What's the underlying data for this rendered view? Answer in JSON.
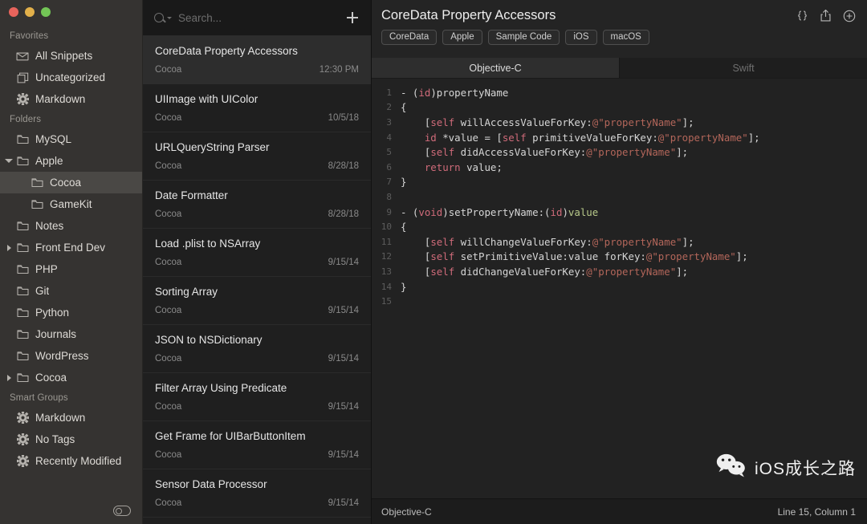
{
  "window": {
    "traffic_lights": [
      "close",
      "minimize",
      "zoom"
    ],
    "colors": {
      "close": "#e8645c",
      "minimize": "#e2b04a",
      "zoom": "#73c556"
    }
  },
  "sidebar": {
    "sections": [
      {
        "title": "Favorites",
        "items": [
          {
            "label": "All Snippets",
            "icon": "inbox-icon",
            "indent": 0,
            "disclosure": "none",
            "selected": false
          },
          {
            "label": "Uncategorized",
            "icon": "stack-icon",
            "indent": 0,
            "disclosure": "none",
            "selected": false
          },
          {
            "label": "Markdown",
            "icon": "gear-icon",
            "indent": 0,
            "disclosure": "none",
            "selected": false
          }
        ]
      },
      {
        "title": "Folders",
        "items": [
          {
            "label": "MySQL",
            "icon": "folder-icon",
            "indent": 0,
            "disclosure": "none",
            "selected": false
          },
          {
            "label": "Apple",
            "icon": "folder-icon",
            "indent": 0,
            "disclosure": "open",
            "selected": false
          },
          {
            "label": "Cocoa",
            "icon": "folder-icon",
            "indent": 1,
            "disclosure": "none",
            "selected": true
          },
          {
            "label": "GameKit",
            "icon": "folder-icon",
            "indent": 1,
            "disclosure": "none",
            "selected": false
          },
          {
            "label": "Notes",
            "icon": "folder-icon",
            "indent": 0,
            "disclosure": "none",
            "selected": false
          },
          {
            "label": "Front End Dev",
            "icon": "folder-icon",
            "indent": 0,
            "disclosure": "closed",
            "selected": false
          },
          {
            "label": "PHP",
            "icon": "folder-icon",
            "indent": 0,
            "disclosure": "none",
            "selected": false
          },
          {
            "label": "Git",
            "icon": "folder-icon",
            "indent": 0,
            "disclosure": "none",
            "selected": false
          },
          {
            "label": "Python",
            "icon": "folder-icon",
            "indent": 0,
            "disclosure": "none",
            "selected": false
          },
          {
            "label": "Journals",
            "icon": "folder-icon",
            "indent": 0,
            "disclosure": "none",
            "selected": false
          },
          {
            "label": "WordPress",
            "icon": "folder-icon",
            "indent": 0,
            "disclosure": "none",
            "selected": false
          },
          {
            "label": "Cocoa",
            "icon": "folder-icon",
            "indent": 0,
            "disclosure": "closed",
            "selected": false
          }
        ]
      },
      {
        "title": "Smart Groups",
        "items": [
          {
            "label": "Markdown",
            "icon": "gear-icon",
            "indent": 0,
            "disclosure": "none",
            "selected": false
          },
          {
            "label": "No Tags",
            "icon": "gear-icon",
            "indent": 0,
            "disclosure": "none",
            "selected": false
          },
          {
            "label": "Recently Modified",
            "icon": "gear-icon",
            "indent": 0,
            "disclosure": "none",
            "selected": false
          }
        ]
      }
    ],
    "bottom_toggle": "sidebar-toggle-icon"
  },
  "search": {
    "placeholder": "Search...",
    "value": "",
    "icon": "search-icon",
    "add_button": "add-snippet-icon"
  },
  "snippets": [
    {
      "title": "CoreData Property Accessors",
      "folder": "Cocoa",
      "date": "12:30 PM",
      "selected": true
    },
    {
      "title": "UIImage with UIColor",
      "folder": "Cocoa",
      "date": "10/5/18",
      "selected": false
    },
    {
      "title": "URLQueryString Parser",
      "folder": "Cocoa",
      "date": "8/28/18",
      "selected": false
    },
    {
      "title": "Date Formatter",
      "folder": "Cocoa",
      "date": "8/28/18",
      "selected": false
    },
    {
      "title": "Load .plist to NSArray",
      "folder": "Cocoa",
      "date": "9/15/14",
      "selected": false
    },
    {
      "title": "Sorting Array",
      "folder": "Cocoa",
      "date": "9/15/14",
      "selected": false
    },
    {
      "title": "JSON to NSDictionary",
      "folder": "Cocoa",
      "date": "9/15/14",
      "selected": false
    },
    {
      "title": "Filter Array Using Predicate",
      "folder": "Cocoa",
      "date": "9/15/14",
      "selected": false
    },
    {
      "title": "Get Frame for UIBarButtonItem",
      "folder": "Cocoa",
      "date": "9/15/14",
      "selected": false
    },
    {
      "title": "Sensor Data Processor",
      "folder": "Cocoa",
      "date": "9/15/14",
      "selected": false
    }
  ],
  "detail": {
    "title": "CoreData Property Accessors",
    "tags": [
      "CoreData",
      "Apple",
      "Sample Code",
      "iOS",
      "macOS"
    ],
    "header_icons": [
      "braces-icon",
      "share-icon",
      "add-circle-icon"
    ],
    "language_tabs": [
      {
        "label": "Objective-C",
        "active": true
      },
      {
        "label": "Swift",
        "active": false
      }
    ],
    "code_lines": [
      {
        "n": "1",
        "tokens": [
          {
            "t": "- (",
            "c": "punc"
          },
          {
            "t": "id",
            "c": "type"
          },
          {
            "t": ")propertyName",
            "c": "plain"
          }
        ]
      },
      {
        "n": "2",
        "tokens": [
          {
            "t": "{",
            "c": "plain"
          }
        ]
      },
      {
        "n": "3",
        "tokens": [
          {
            "t": "    [",
            "c": "plain"
          },
          {
            "t": "self",
            "c": "self"
          },
          {
            "t": " willAccessValueForKey:",
            "c": "plain"
          },
          {
            "t": "@\"propertyName\"",
            "c": "str"
          },
          {
            "t": "];",
            "c": "plain"
          }
        ]
      },
      {
        "n": "4",
        "tokens": [
          {
            "t": "    ",
            "c": "plain"
          },
          {
            "t": "id",
            "c": "type"
          },
          {
            "t": " *value = [",
            "c": "plain"
          },
          {
            "t": "self",
            "c": "self"
          },
          {
            "t": " primitiveValueForKey:",
            "c": "plain"
          },
          {
            "t": "@\"propertyName\"",
            "c": "str"
          },
          {
            "t": "];",
            "c": "plain"
          }
        ]
      },
      {
        "n": "5",
        "tokens": [
          {
            "t": "    [",
            "c": "plain"
          },
          {
            "t": "self",
            "c": "self"
          },
          {
            "t": " didAccessValueForKey:",
            "c": "plain"
          },
          {
            "t": "@\"propertyName\"",
            "c": "str"
          },
          {
            "t": "];",
            "c": "plain"
          }
        ]
      },
      {
        "n": "6",
        "tokens": [
          {
            "t": "    ",
            "c": "plain"
          },
          {
            "t": "return",
            "c": "ret"
          },
          {
            "t": " value;",
            "c": "plain"
          }
        ]
      },
      {
        "n": "7",
        "tokens": [
          {
            "t": "}",
            "c": "plain"
          }
        ]
      },
      {
        "n": "8",
        "tokens": []
      },
      {
        "n": "9",
        "tokens": [
          {
            "t": "- (",
            "c": "punc"
          },
          {
            "t": "void",
            "c": "type"
          },
          {
            "t": ")setPropertyName:(",
            "c": "plain"
          },
          {
            "t": "id",
            "c": "type"
          },
          {
            "t": ")",
            "c": "plain"
          },
          {
            "t": "value",
            "c": "var"
          }
        ]
      },
      {
        "n": "10",
        "tokens": [
          {
            "t": "{",
            "c": "plain"
          }
        ]
      },
      {
        "n": "11",
        "tokens": [
          {
            "t": "    [",
            "c": "plain"
          },
          {
            "t": "self",
            "c": "self"
          },
          {
            "t": " willChangeValueForKey:",
            "c": "plain"
          },
          {
            "t": "@\"propertyName\"",
            "c": "str"
          },
          {
            "t": "];",
            "c": "plain"
          }
        ]
      },
      {
        "n": "12",
        "tokens": [
          {
            "t": "    [",
            "c": "plain"
          },
          {
            "t": "self",
            "c": "self"
          },
          {
            "t": " setPrimitiveValue:value forKey:",
            "c": "plain"
          },
          {
            "t": "@\"propertyName\"",
            "c": "str"
          },
          {
            "t": "];",
            "c": "plain"
          }
        ]
      },
      {
        "n": "13",
        "tokens": [
          {
            "t": "    [",
            "c": "plain"
          },
          {
            "t": "self",
            "c": "self"
          },
          {
            "t": " didChangeValueForKey:",
            "c": "plain"
          },
          {
            "t": "@\"propertyName\"",
            "c": "str"
          },
          {
            "t": "];",
            "c": "plain"
          }
        ]
      },
      {
        "n": "14",
        "tokens": [
          {
            "t": "}",
            "c": "plain"
          }
        ]
      },
      {
        "n": "15",
        "tokens": []
      }
    ],
    "status": {
      "language": "Objective-C",
      "cursor": "Line 15, Column 1"
    }
  },
  "watermark": {
    "text": "iOS成长之路",
    "icon": "wechat-icon"
  }
}
